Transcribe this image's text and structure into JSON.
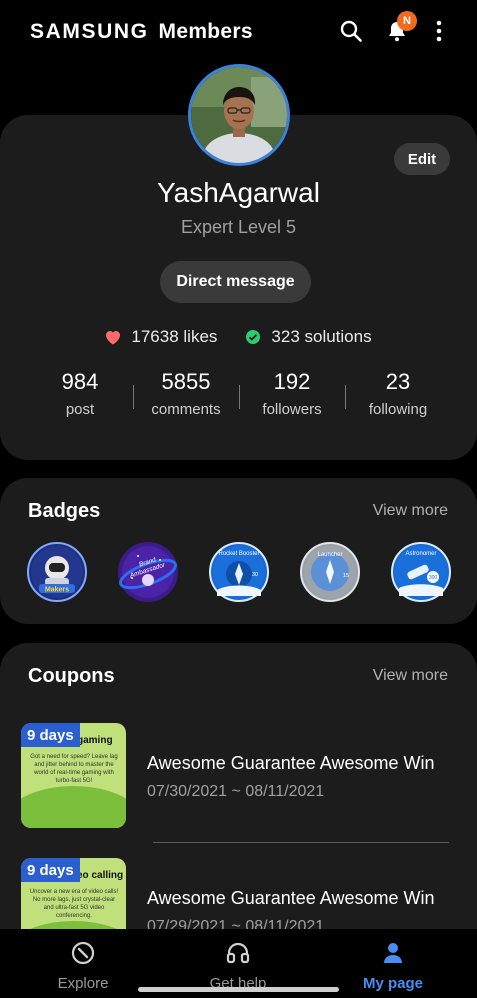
{
  "header": {
    "brand_primary": "SAMSUNG",
    "brand_secondary": "Members",
    "notification_badge": "N",
    "icons": [
      "search-icon",
      "bell-icon",
      "more-vertical-icon"
    ]
  },
  "profile": {
    "username": "YashAgarwal",
    "level": "Expert Level 5",
    "edit_label": "Edit",
    "direct_message_label": "Direct message",
    "likes": "17638 likes",
    "solutions": "323 solutions",
    "counts": [
      {
        "value": "984",
        "label": "post"
      },
      {
        "value": "5855",
        "label": "comments"
      },
      {
        "value": "192",
        "label": "followers"
      },
      {
        "value": "23",
        "label": "following"
      }
    ]
  },
  "badges": {
    "title": "Badges",
    "view_more": "View more",
    "items": [
      {
        "name": "makers-badge",
        "label": "Makers"
      },
      {
        "name": "brand-ambassador-badge",
        "label": "Brand Ambassador"
      },
      {
        "name": "rocket-booster-badge",
        "label": "Rocket Booster"
      },
      {
        "name": "launcher-badge",
        "label": "Launcher"
      },
      {
        "name": "astronomer-badge",
        "label": "Astronomer"
      }
    ]
  },
  "coupons": {
    "title": "Coupons",
    "view_more": "View more",
    "items": [
      {
        "days": "9 days",
        "thumb_title": "gaming",
        "thumb_desc": "Got a need for speed? Leave lag and jitter behind to master the world of real-time gaming with turbo-fast 5G!",
        "title": "Awesome Guarantee Awesome Win",
        "date": "07/30/2021 ~ 08/11/2021"
      },
      {
        "days": "9 days",
        "thumb_title": "eo calling",
        "thumb_desc": "Uncover a new era of video calls! No more lags, just crystal-clear and ultra-fast 5G video conferencing.",
        "title": "Awesome Guarantee Awesome Win",
        "date": "07/29/2021 ~ 08/11/2021"
      }
    ]
  },
  "bottom_nav": {
    "items": [
      {
        "label": "Explore",
        "icon": "compass-icon",
        "active": false
      },
      {
        "label": "Get help",
        "icon": "headset-icon",
        "active": false
      },
      {
        "label": "My page",
        "icon": "person-icon",
        "active": true
      }
    ]
  },
  "colors": {
    "background": "#000000",
    "card": "#1c1c1c",
    "accent_blue": "#4a8df2",
    "notification_orange": "#f26b1d",
    "like_red": "#ff6b6b",
    "solution_green": "#2ecc71"
  }
}
